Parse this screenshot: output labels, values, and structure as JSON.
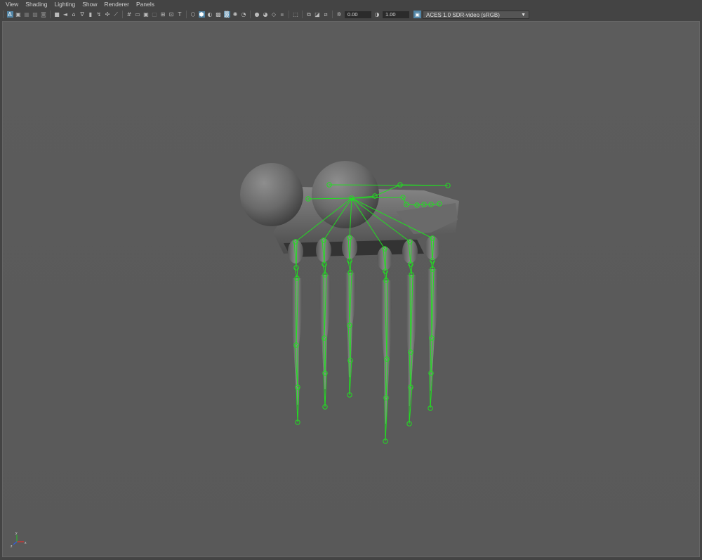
{
  "menu": {
    "items": [
      "View",
      "Shading",
      "Lighting",
      "Show",
      "Renderer",
      "Panels"
    ]
  },
  "toolbar": {
    "exposure_value": "0.00",
    "gamma_value": "1.00",
    "color_space": "ACES 1.0 SDR-video (sRGB)",
    "icons": [
      "select-camera-icon",
      "camera-attributes-icon",
      "bookmarks-icon",
      "image-plane-icon",
      "2d-pan-zoom-icon",
      "grease-pencil-icon",
      "grid-icon",
      "film-gate-icon",
      "resolution-gate-icon",
      "gate-mask-icon",
      "field-chart-icon",
      "safe-action-icon",
      "safe-title-icon",
      "wireframe-icon",
      "smooth-shade-icon",
      "default-material-icon",
      "textured-icon",
      "use-all-lights-icon",
      "shadows-icon",
      "screen-space-ao-icon",
      "motion-blur-icon",
      "anti-aliasing-icon",
      "depth-of-field-icon",
      "isolate-select-icon",
      "xray-icon",
      "xray-joints-icon",
      "backface-culling-icon",
      "exposure-icon",
      "gamma-icon"
    ]
  },
  "viewport": {
    "background": "#5a5a5a",
    "joint_color": "#22dd22",
    "axis_labels": {
      "x": "x",
      "y": "y",
      "z": "z"
    }
  }
}
